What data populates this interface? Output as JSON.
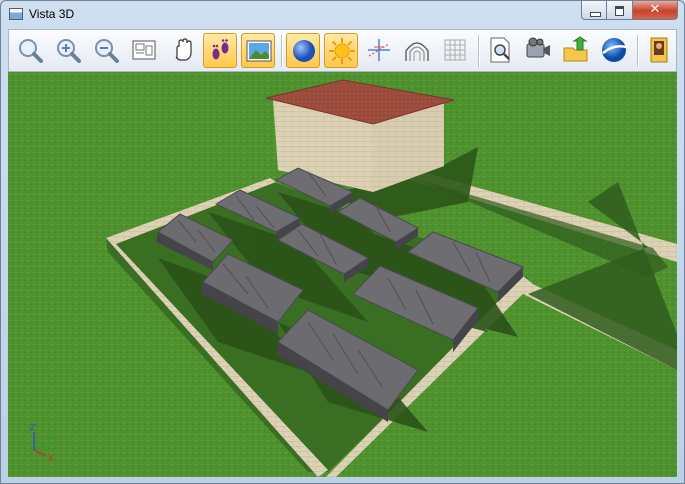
{
  "window": {
    "title": "Vista 3D",
    "controls": {
      "close": "✕"
    }
  },
  "toolbar": {
    "buttons": [
      {
        "id": "zoom-fit",
        "icon": "zoom-fit-icon",
        "active": false
      },
      {
        "id": "zoom-in",
        "icon": "zoom-in-icon",
        "active": false
      },
      {
        "id": "zoom-out",
        "icon": "zoom-out-icon",
        "active": false
      },
      {
        "id": "view-2d",
        "icon": "plan-view-icon",
        "active": false
      },
      {
        "id": "pan",
        "icon": "hand-icon",
        "active": false
      },
      {
        "id": "walk",
        "icon": "footsteps-icon",
        "active": true
      },
      {
        "id": "background",
        "icon": "landscape-image-icon",
        "active": true
      },
      {
        "id": "sky",
        "icon": "blue-sphere-icon",
        "active": true
      },
      {
        "id": "sun",
        "icon": "sun-icon",
        "active": true
      },
      {
        "id": "axes",
        "icon": "axes-icon",
        "active": false
      },
      {
        "id": "shading",
        "icon": "wireframe-arch-icon",
        "active": false
      },
      {
        "id": "grid",
        "icon": "grid-icon",
        "active": false
      },
      {
        "id": "preview",
        "icon": "print-preview-icon",
        "active": false
      },
      {
        "id": "camera",
        "icon": "video-camera-icon",
        "active": false
      },
      {
        "id": "export",
        "icon": "folder-export-icon",
        "active": false
      },
      {
        "id": "google-earth",
        "icon": "google-earth-icon",
        "active": false
      },
      {
        "id": "gallery",
        "icon": "photo-gallery-icon",
        "active": false
      }
    ]
  },
  "scene": {
    "colors": {
      "grass": "#4b8b2d",
      "roof": "#9a4a3a",
      "wall": "#d8ccb0",
      "panel": "#6b6b70",
      "shadow": "#2e5a1c"
    },
    "axes": {
      "x": "X",
      "y": "Y",
      "z": "Z"
    }
  }
}
